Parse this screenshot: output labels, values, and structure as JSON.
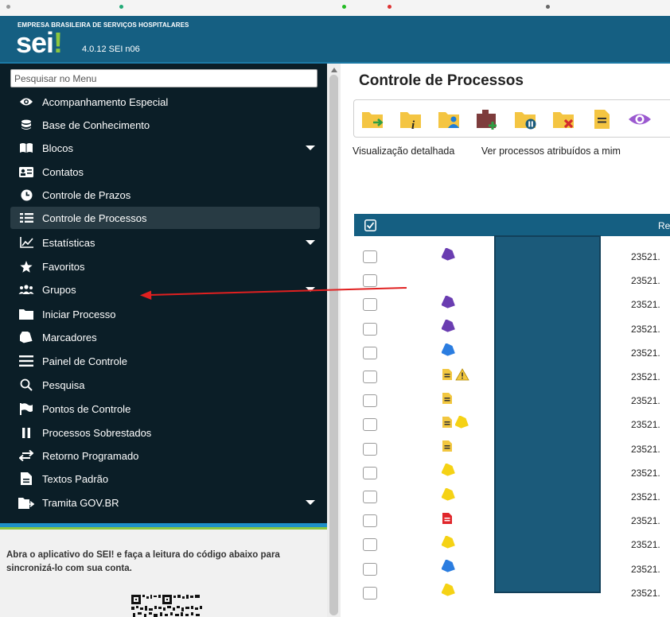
{
  "header": {
    "org_name": "EMPRESA BRASILEIRA DE SERVIÇOS HOSPITALARES",
    "logo_text": "sei",
    "logo_mark": "!",
    "version": "4.0.12 SEI n06"
  },
  "sidebar": {
    "search_placeholder": "Pesquisar no Menu",
    "items": [
      {
        "label": "Acompanhamento Especial",
        "icon": "eye-icon",
        "has_submenu": false
      },
      {
        "label": "Base de Conhecimento",
        "icon": "database-icon",
        "has_submenu": false
      },
      {
        "label": "Blocos",
        "icon": "book-icon",
        "has_submenu": true
      },
      {
        "label": "Contatos",
        "icon": "contact-card-icon",
        "has_submenu": false
      },
      {
        "label": "Controle de Prazos",
        "icon": "clock-icon",
        "has_submenu": false
      },
      {
        "label": "Controle de Processos",
        "icon": "list-icon",
        "has_submenu": false,
        "active": true
      },
      {
        "label": "Estatísticas",
        "icon": "chart-line-icon",
        "has_submenu": true
      },
      {
        "label": "Favoritos",
        "icon": "star-icon",
        "has_submenu": false
      },
      {
        "label": "Grupos",
        "icon": "users-icon",
        "has_submenu": true
      },
      {
        "label": "Iniciar Processo",
        "icon": "folder-icon",
        "has_submenu": false
      },
      {
        "label": "Marcadores",
        "icon": "tag-icon",
        "has_submenu": false
      },
      {
        "label": "Painel de Controle",
        "icon": "bars-icon",
        "has_submenu": false
      },
      {
        "label": "Pesquisa",
        "icon": "search-icon",
        "has_submenu": false
      },
      {
        "label": "Pontos de Controle",
        "icon": "flag-icon",
        "has_submenu": false
      },
      {
        "label": "Processos Sobrestados",
        "icon": "pause-icon",
        "has_submenu": false
      },
      {
        "label": "Retorno Programado",
        "icon": "exchange-icon",
        "has_submenu": false
      },
      {
        "label": "Textos Padrão",
        "icon": "document-icon",
        "has_submenu": false
      },
      {
        "label": "Tramita GOV.BR",
        "icon": "folder-send-icon",
        "has_submenu": true
      }
    ],
    "qr_text": "Abra o aplicativo do SEI! e faça a leitura do código abaixo para sincronizá-lo com sua conta."
  },
  "main": {
    "title": "Controle de Processos",
    "toolbar": [
      "folder-arrow-icon",
      "folder-info-icon",
      "folder-user-icon",
      "folder-plus-icon",
      "folder-pause-icon",
      "folder-cancel-icon",
      "note-icon",
      "eye-icon"
    ],
    "links": [
      "Visualização detalhada",
      "Ver processos atribuídos a mim"
    ],
    "table": {
      "header_partial": "Re",
      "rows": [
        {
          "icons": [
            "purple-tag"
          ],
          "number": "23521."
        },
        {
          "icons": [],
          "number": "23521."
        },
        {
          "icons": [
            "purple-tag"
          ],
          "number": "23521."
        },
        {
          "icons": [
            "purple-tag"
          ],
          "number": "23521."
        },
        {
          "icons": [
            "blue-tag"
          ],
          "number": "23521."
        },
        {
          "icons": [
            "note",
            "warning"
          ],
          "number": "23521."
        },
        {
          "icons": [
            "note"
          ],
          "number": "23521."
        },
        {
          "icons": [
            "note",
            "yellow-tag"
          ],
          "number": "23521."
        },
        {
          "icons": [
            "note"
          ],
          "number": "23521."
        },
        {
          "icons": [
            "yellow-tag"
          ],
          "number": "23521."
        },
        {
          "icons": [
            "yellow-tag"
          ],
          "number": "23521."
        },
        {
          "icons": [
            "red-note"
          ],
          "number": "23521."
        },
        {
          "icons": [
            "yellow-tag"
          ],
          "number": "23521."
        },
        {
          "icons": [
            "blue-tag"
          ],
          "number": "23521."
        },
        {
          "icons": [
            "yellow-tag"
          ],
          "number": "23521."
        }
      ]
    }
  },
  "colors": {
    "header": "#155f82",
    "sidebar": "#0b1e27",
    "accent_green": "#8cc63f",
    "folder_yellow": "#f4c542",
    "annotation_arrow": "#e02020"
  }
}
